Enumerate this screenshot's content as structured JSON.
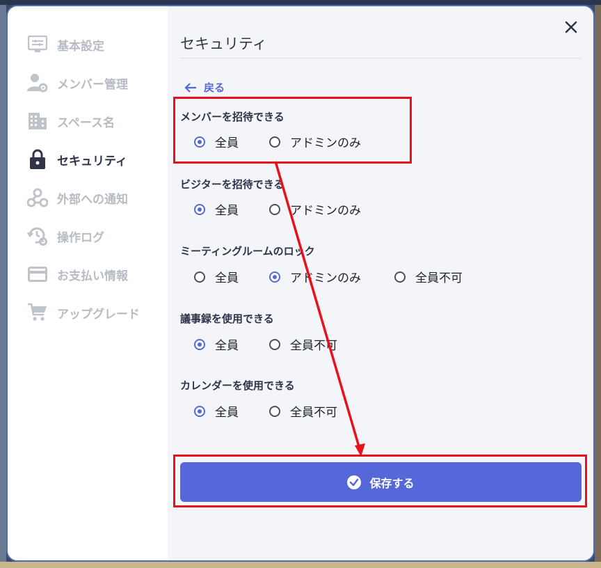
{
  "sidebar": {
    "items": [
      {
        "label": "基本設定",
        "icon": "settings-panel-icon"
      },
      {
        "label": "メンバー管理",
        "icon": "user-gear-icon"
      },
      {
        "label": "スペース名",
        "icon": "building-icon"
      },
      {
        "label": "セキュリティ",
        "icon": "lock-icon"
      },
      {
        "label": "外部への通知",
        "icon": "webhook-icon"
      },
      {
        "label": "操作ログ",
        "icon": "history-gear-icon"
      },
      {
        "label": "お支払い情報",
        "icon": "credit-card-icon"
      },
      {
        "label": "アップグレード",
        "icon": "cart-icon"
      }
    ],
    "active_index": 3
  },
  "main": {
    "title": "セキュリティ",
    "back_label": "戻る",
    "groups": [
      {
        "label": "メンバーを招待できる",
        "options": [
          "全員",
          "アドミンのみ"
        ],
        "selected": "全員"
      },
      {
        "label": "ビジターを招待できる",
        "options": [
          "全員",
          "アドミンのみ"
        ],
        "selected": "全員"
      },
      {
        "label": "ミーティングルームのロック",
        "options": [
          "全員",
          "アドミンのみ",
          "全員不可"
        ],
        "selected": "アドミンのみ"
      },
      {
        "label": "議事録を使用できる",
        "options": [
          "全員",
          "全員不可"
        ],
        "selected": "全員"
      },
      {
        "label": "カレンダーを使用できる",
        "options": [
          "全員",
          "全員不可"
        ],
        "selected": "全員"
      }
    ],
    "save_label": "保存する"
  },
  "colors": {
    "accent": "#5567d9",
    "highlight": "#e8101a",
    "sidebar_inactive": "#b7bcc4",
    "text_dark": "#2f3448"
  }
}
